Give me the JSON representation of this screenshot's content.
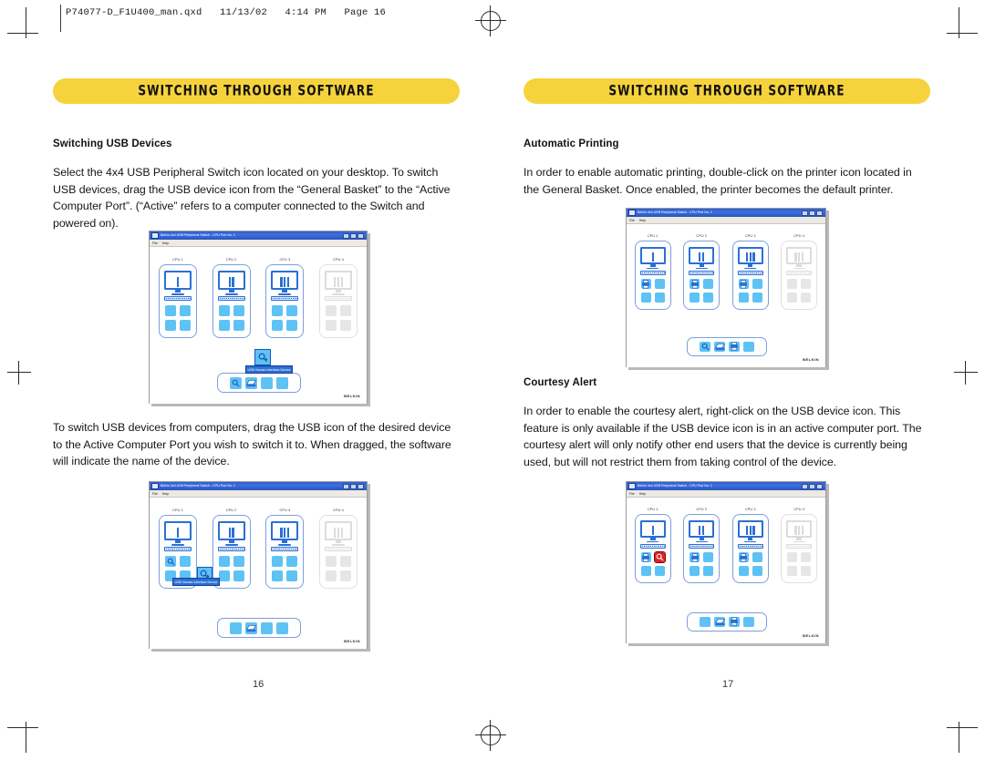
{
  "slug": "P74077-D_F1U400_man.qxd   11/13/02   4:14 PM   Page 16",
  "left_page": {
    "banner": "SWITCHING THROUGH SOFTWARE",
    "section1_heading": "Switching USB Devices",
    "section1_body": "Select the 4x4 USB Peripheral Switch icon located on your desktop. To switch USB devices, drag the USB device icon from the “General Basket” to the “Active Computer Port”. (“Active” refers to a computer connected to the Switch and powered on).",
    "section2_body": "To switch USB devices from computers, drag the USB icon of the desired device to the Active Computer Port you wish to switch it to. When dragged, the software will indicate the name of the device.",
    "page_number": "16"
  },
  "right_page": {
    "banner": "SWITCHING THROUGH SOFTWARE",
    "section1_heading": "Automatic Printing",
    "section1_body": "In order to enable automatic printing, double-click on the printer icon located in the General Basket. Once enabled, the printer becomes the default printer.",
    "section2_heading": "Courtesy Alert",
    "section2_body": "In order to enable the courtesy alert, right-click on the USB device icon. This feature is only available if the USB device icon is in an active computer port. The courtesy alert will only notify other end users that the device is currently being used, but will not restrict them from taking control of the device.",
    "page_number": "17"
  },
  "app_window": {
    "title": "Belkin 4x4 USB Peripheral Switch - CPU Port No. 1",
    "menus": [
      "File",
      "Help"
    ],
    "window_buttons": [
      "minimize",
      "maximize",
      "close"
    ],
    "brand": "BELKIN",
    "port_labels": [
      "CPU 1",
      "CPU 2",
      "CPU 3",
      "CPU 4"
    ]
  },
  "screenshot_1": {
    "caption_context": "Switching USB Devices – dragging USB device onto CPU 3",
    "ports": [
      {
        "label": "CPU 1",
        "active": true,
        "monitor_bars": 1,
        "slots": [
          "blue",
          "blue",
          "blue",
          "blue"
        ]
      },
      {
        "label": "CPU 2",
        "active": true,
        "monitor_bars": 2,
        "slots": [
          "blue",
          "blue",
          "blue",
          "blue"
        ]
      },
      {
        "label": "CPU 3",
        "active": true,
        "monitor_bars": 3,
        "slots": [
          "blue",
          "blue",
          "blue",
          "blue"
        ]
      },
      {
        "label": "CPU 4",
        "active": false,
        "monitor_bars": 3,
        "slots": [
          "gray",
          "gray",
          "gray",
          "gray"
        ]
      }
    ],
    "basket": [
      "mouse",
      "scanner",
      "blue",
      "blue"
    ],
    "drag_label": "USB Human Interface Device",
    "drag_icon": "mouse-cursor-icon"
  },
  "screenshot_2": {
    "caption_context": "Dragging USB icon from CPU 1 toward CPU 2",
    "ports": [
      {
        "label": "CPU 1",
        "active": true,
        "monitor_bars": 1,
        "slots": [
          "mouse",
          "blue",
          "blue",
          "blue"
        ]
      },
      {
        "label": "CPU 2",
        "active": true,
        "monitor_bars": 2,
        "slots": [
          "blue",
          "blue",
          "blue",
          "blue"
        ]
      },
      {
        "label": "CPU 3",
        "active": true,
        "monitor_bars": 3,
        "slots": [
          "blue",
          "blue",
          "blue",
          "blue"
        ]
      },
      {
        "label": "CPU 4",
        "active": false,
        "monitor_bars": 3,
        "slots": [
          "gray",
          "gray",
          "gray",
          "gray"
        ]
      }
    ],
    "basket": [
      "blue",
      "scanner",
      "blue",
      "blue"
    ],
    "drag_label": "USB Human Interface Device",
    "drag_icon": "mouse-cursor-icon"
  },
  "screenshot_3": {
    "caption_context": "Automatic Printing – printer icons assigned to CPU 1, 2 and 3",
    "ports": [
      {
        "label": "CPU 1",
        "active": true,
        "monitor_bars": 1,
        "slots": [
          "printer",
          "blue",
          "blue",
          "blue"
        ]
      },
      {
        "label": "CPU 2",
        "active": true,
        "monitor_bars": 2,
        "slots": [
          "printer",
          "blue",
          "blue",
          "blue"
        ]
      },
      {
        "label": "CPU 3",
        "active": true,
        "monitor_bars": 3,
        "slots": [
          "printer",
          "blue",
          "blue",
          "blue"
        ]
      },
      {
        "label": "CPU 4",
        "active": false,
        "monitor_bars": 3,
        "slots": [
          "gray",
          "gray",
          "gray",
          "gray"
        ]
      }
    ],
    "basket": [
      "mouse",
      "scanner",
      "printer",
      "blue"
    ]
  },
  "screenshot_4": {
    "caption_context": "Courtesy Alert – red alert state on USB device in CPU 1",
    "ports": [
      {
        "label": "CPU 1",
        "active": true,
        "monitor_bars": 1,
        "slots": [
          "printer",
          "alert",
          "blue",
          "blue"
        ]
      },
      {
        "label": "CPU 2",
        "active": true,
        "monitor_bars": 2,
        "slots": [
          "printer",
          "blue",
          "blue",
          "blue"
        ]
      },
      {
        "label": "CPU 3",
        "active": true,
        "monitor_bars": 3,
        "slots": [
          "printer",
          "blue",
          "blue",
          "blue"
        ]
      },
      {
        "label": "CPU 4",
        "active": false,
        "monitor_bars": 3,
        "slots": [
          "gray",
          "gray",
          "gray",
          "gray"
        ]
      }
    ],
    "basket": [
      "blue",
      "scanner",
      "printer",
      "blue"
    ]
  },
  "colors": {
    "banner_yellow": "#f6d33c",
    "slot_blue": "#5ec2f5",
    "monitor_blue": "#2a6fd6",
    "alert_red": "#e02020",
    "inactive_gray": "#e6e6e6"
  }
}
